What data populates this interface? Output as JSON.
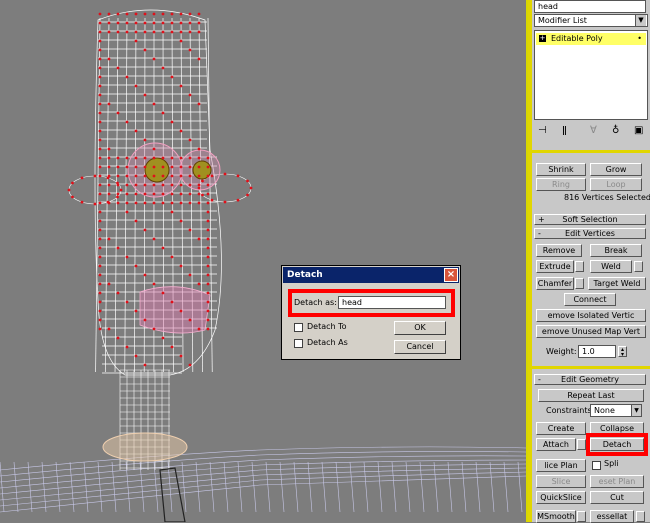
{
  "panel": {
    "object_name": "head",
    "modifier_list": "Modifier List",
    "stack_item": "Editable Poly",
    "selection": {
      "shrink": "Shrink",
      "grow": "Grow",
      "ring": "Ring",
      "loop": "Loop",
      "status": "816 Vertices Selected"
    },
    "soft_selection": "Soft Selection",
    "edit_vertices": {
      "title": "Edit Vertices",
      "remove": "Remove",
      "break": "Break",
      "extrude": "Extrude",
      "weld": "Weld",
      "chamfer": "Chamfer",
      "target_weld": "Target Weld",
      "connect": "Connect",
      "remove_isolated": "emove Isolated Vertic",
      "remove_unused": "emove Unused Map Vert",
      "weight_label": "Weight:",
      "weight_value": "1.0"
    },
    "edit_geometry": {
      "title": "Edit Geometry",
      "repeat_last": "Repeat Last",
      "constraints_label": "Constraints",
      "constraints_value": "None",
      "create": "Create",
      "collapse": "Collapse",
      "attach": "Attach",
      "detach": "Detach",
      "slice_plane": "lice Plan",
      "split": "Spli",
      "slice": "Slice",
      "reset_plane": "eset Plan",
      "quickslice": "QuickSlice",
      "cut": "Cut",
      "msmooth": "MSmooth",
      "tessellate": "essellat"
    }
  },
  "dialog": {
    "title": "Detach",
    "close_glyph": "×",
    "detach_as_label": "Detach as:",
    "detach_as_value": "head",
    "detach_to_element": "Detach To",
    "detach_as_clone": "Detach As",
    "ok": "OK",
    "cancel": "Cancel"
  },
  "colors": {
    "viewport_bg": "#7d7d7d",
    "wire_white": "#ffffff",
    "vertex_red": "#e0101a",
    "highlight_red": "#ff0000",
    "panel_bg": "#c8c8c8",
    "panel_accent": "#e1d600"
  }
}
